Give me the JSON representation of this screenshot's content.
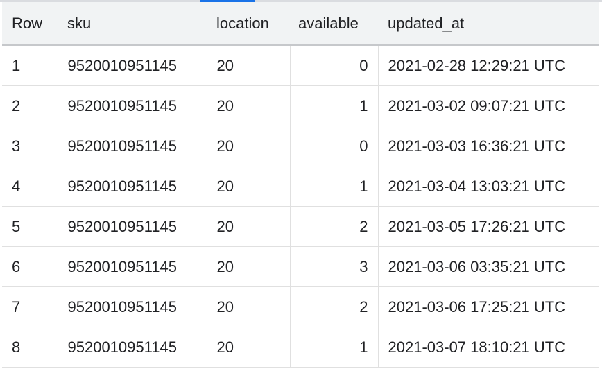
{
  "columns": [
    "Row",
    "sku",
    "location",
    "available",
    "updated_at"
  ],
  "rows": [
    [
      "1",
      "9520010951145",
      "20",
      "0",
      "2021-02-28 12:29:21 UTC"
    ],
    [
      "2",
      "9520010951145",
      "20",
      "1",
      "2021-03-02 09:07:21 UTC"
    ],
    [
      "3",
      "9520010951145",
      "20",
      "0",
      "2021-03-03 16:36:21 UTC"
    ],
    [
      "4",
      "9520010951145",
      "20",
      "1",
      "2021-03-04 13:03:21 UTC"
    ],
    [
      "5",
      "9520010951145",
      "20",
      "2",
      "2021-03-05 17:26:21 UTC"
    ],
    [
      "6",
      "9520010951145",
      "20",
      "3",
      "2021-03-06 03:35:21 UTC"
    ],
    [
      "7",
      "9520010951145",
      "20",
      "2",
      "2021-03-06 17:25:21 UTC"
    ],
    [
      "8",
      "9520010951145",
      "20",
      "1",
      "2021-03-07 18:10:21 UTC"
    ]
  ]
}
